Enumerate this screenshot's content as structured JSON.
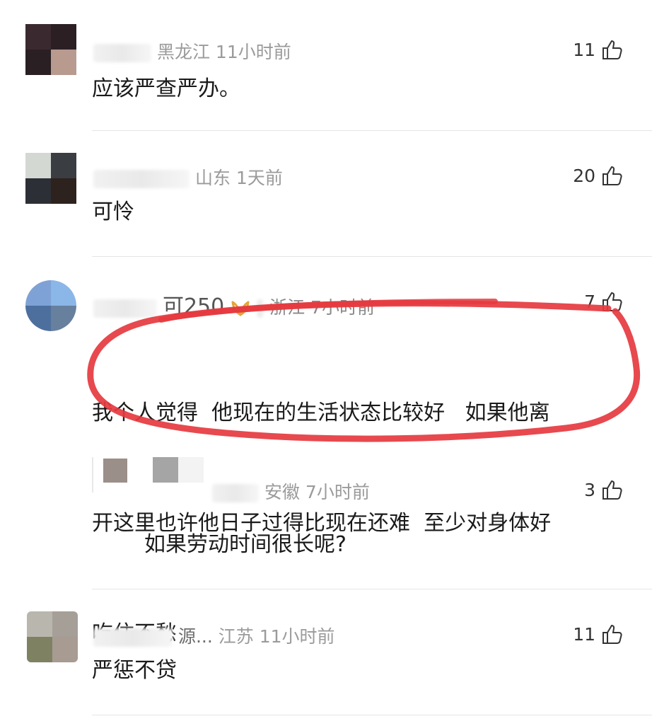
{
  "comments": [
    {
      "location": "黑龙江",
      "time": "11小时前",
      "likes": "11",
      "text": "应该严查严办。",
      "avatar_colors": [
        "#3a2a30",
        "#2b1f24",
        "#2a1f22",
        "#b99a8f"
      ]
    },
    {
      "location": "山东",
      "time": "1天前",
      "likes": "20",
      "text": "可怜",
      "avatar_colors": [
        "#d4d8d2",
        "#3a3d42",
        "#2c2f36",
        "#2d221d"
      ]
    },
    {
      "username_fragment": "可250",
      "location": "浙江",
      "time": "7小时前",
      "likes": "7",
      "text_lines": [
        "我个人觉得  他现在的生活状态比较好   如果他离",
        "开这里也许他日子过得比现在还难  至少对身体好",
        "吃住不愁"
      ],
      "avatar_colors": [
        "#7fa2d6",
        "#8bb6e8",
        "#4d6f9e",
        "#66809e"
      ],
      "highlight_color": "#e5393f"
    },
    {
      "is_reply": true,
      "location": "安徽",
      "time": "7小时前",
      "likes": "3",
      "text": "如果劳动时间很长呢?"
    },
    {
      "username_fragment": "源...",
      "location": "江苏",
      "time": "11小时前",
      "likes": "11",
      "text": "严惩不贷",
      "avatar_colors": [
        "#b9b7ad",
        "#a59f98",
        "#7f8163",
        "#a89b92"
      ]
    }
  ],
  "icons": {
    "like": "thumbs-up-icon"
  }
}
